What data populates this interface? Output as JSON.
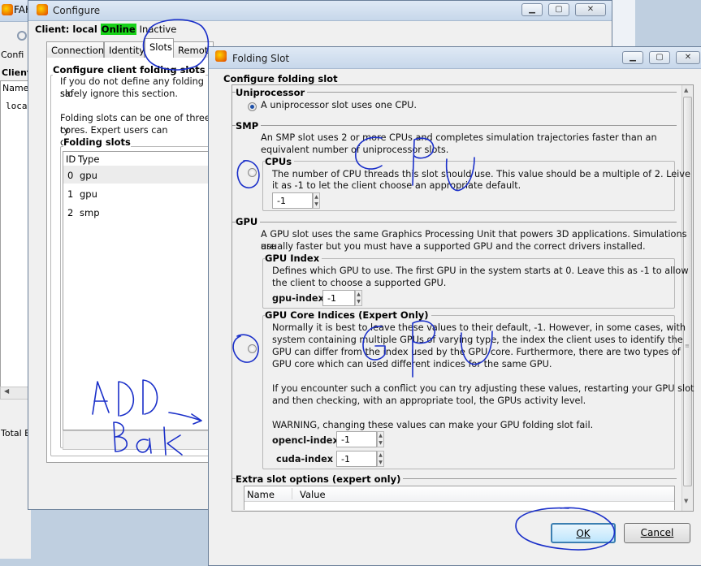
{
  "background_app": {
    "title": "FAH",
    "client_label": "Client",
    "config_label": "Confi",
    "name_col": "Name",
    "local_item": "local",
    "total_label": "Total E"
  },
  "configure_window": {
    "title": "Configure",
    "client_label": "Client: local",
    "status_online": "Online",
    "status_inactive": "Inactive",
    "tabs": [
      "Connection",
      "Identity",
      "Slots",
      "Remot"
    ],
    "active_tab": "Slots",
    "group_title": "Configure client folding slots",
    "intro_line1": "If you do not define any folding slo",
    "intro_line2": "safely ignore this section.",
    "intro_line3": "Folding slots can be one of three ty",
    "intro_line4": "cores.  Expert users can configure m",
    "slots_group_title": "Folding slots",
    "columns": [
      "ID",
      "Type"
    ],
    "rows": [
      {
        "id": "0",
        "type": "gpu"
      },
      {
        "id": "1",
        "type": "gpu"
      },
      {
        "id": "2",
        "type": "smp"
      }
    ]
  },
  "dialog": {
    "title": "Folding Slot",
    "heading": "Configure folding slot",
    "uniprocessor": {
      "title": "Uniprocessor",
      "desc": "A uniprocessor slot uses one CPU."
    },
    "smp": {
      "title": "SMP",
      "desc1": "An SMP slot uses 2 or more CPUs and completes simulation trajectories faster than an",
      "desc2": "equivalent number of uniprocessor slots.",
      "cpus_title": "CPUs",
      "cpus_desc1": "The number of CPU threads this slot should use.  This value should be a multiple of 2.  Leive",
      "cpus_desc2": "it as -1 to let the client choose an appropriate default.",
      "cpus_value": "-1"
    },
    "gpu": {
      "title": "GPU",
      "desc1": "A GPU slot uses the same Graphics Processing Unit that powers 3D applications.  Simulations are",
      "desc2": "usually faster but you must have a supported GPU and the correct drivers installed.",
      "index_title": "GPU Index",
      "index_desc1": "Defines which GPU to use.  The first GPU in the system starts at 0.  Leave this as -1 to allow",
      "index_desc2": "the client to choose a supported GPU.",
      "gpu_index_label": "gpu-index",
      "gpu_index_value": "-1",
      "core_title": "GPU Core Indices (Expert Only)",
      "core_desc1": "Normally it is best to leave these values to their default, -1.  However, in some cases, with",
      "core_desc2": "system containing multiple GPUs of varying type, the index the client uses to identify the",
      "core_desc3": "GPU can differ from the index used by the GPU core.  Furthermore, there are two types of",
      "core_desc4": "GPU core which can used different indices for the same GPU.",
      "core_desc5": "If you encounter such a conflict you can try adjusting these values, restarting your GPU slot",
      "core_desc6": "and then checking, with an appropriate tool, the GPUs activity level.",
      "warning": "WARNING, changing these values can make your GPU folding slot fail.",
      "opencl_label": "opencl-index",
      "opencl_value": "-1",
      "cuda_label": "cuda-index",
      "cuda_value": "-1"
    },
    "extra": {
      "title": "Extra slot options (expert only)",
      "columns": [
        "Name",
        "Value"
      ]
    },
    "ok_label": "OK",
    "cancel_label": "Cancel"
  },
  "annotations": {
    "ink_color": "#1a2fc9"
  }
}
